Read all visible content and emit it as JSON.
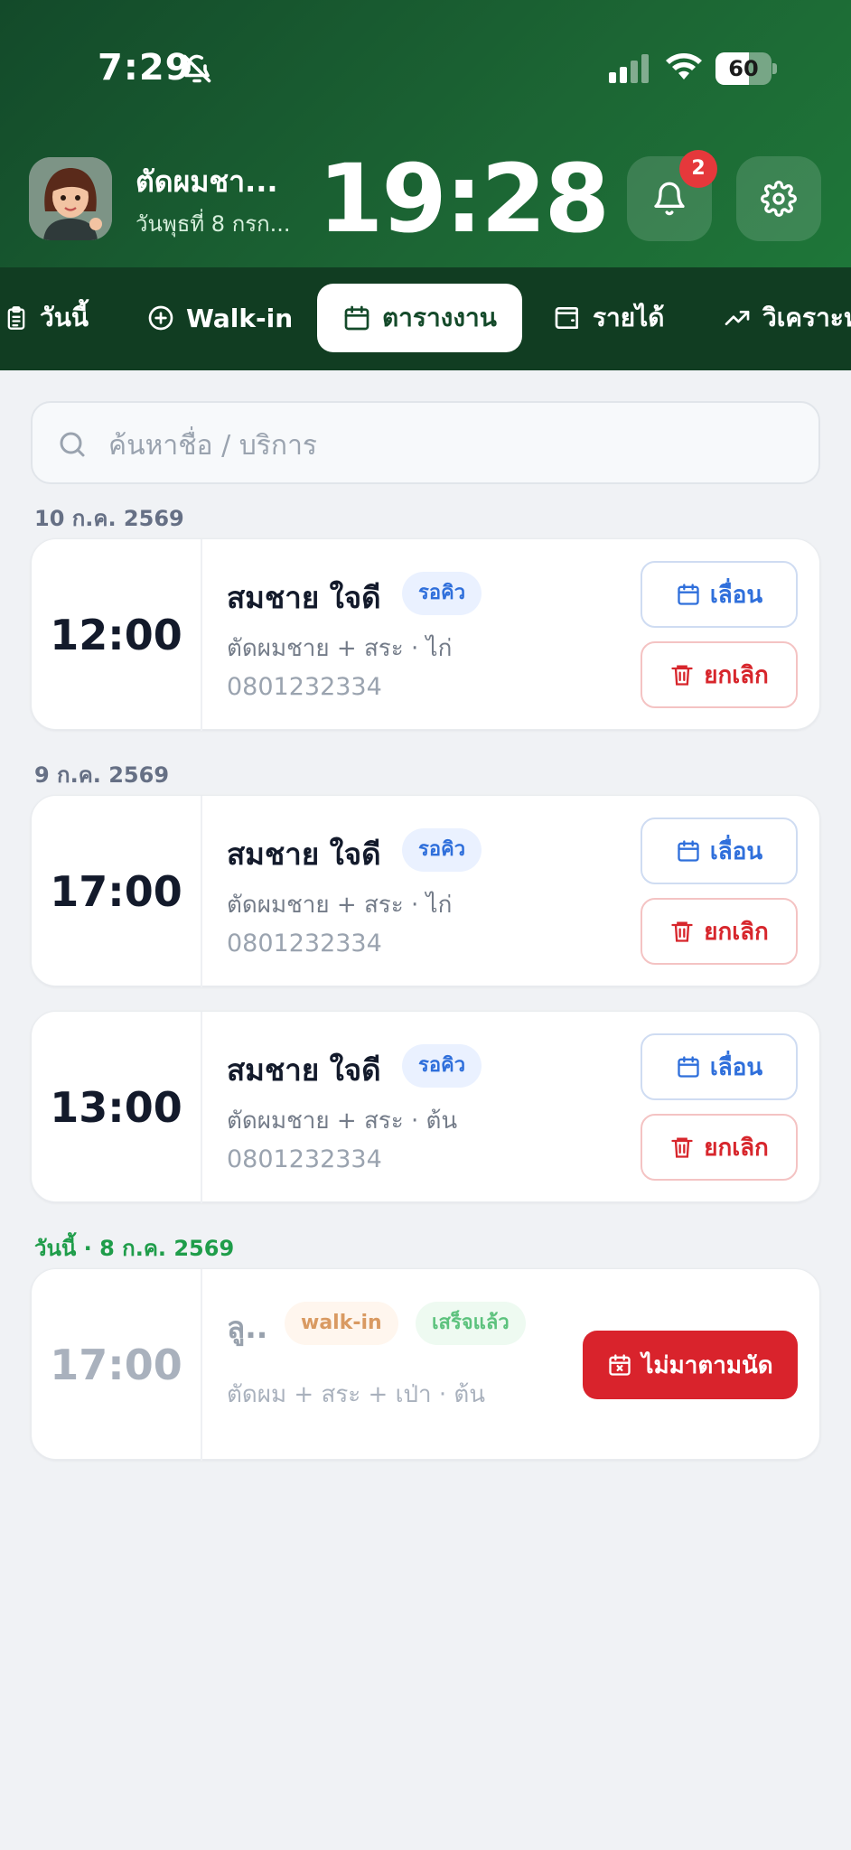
{
  "status_bar": {
    "time": "7:29",
    "battery": 60
  },
  "header": {
    "shop_name": "ตัดผมชา...",
    "date": "วันพุธที่ 8 กรก...",
    "clock": "19:28",
    "notification_count": "2"
  },
  "tabs": [
    {
      "label": "วันนี้",
      "icon": "clipboard-icon"
    },
    {
      "label": "Walk-in",
      "icon": "plus-circle-icon"
    },
    {
      "label": "ตารางงาน",
      "icon": "calendar-icon",
      "active": true
    },
    {
      "label": "รายได้",
      "icon": "wallet-icon"
    },
    {
      "label": "วิเคราะห์",
      "icon": "trend-up-icon"
    }
  ],
  "search": {
    "placeholder": "ค้นหาชื่อ / บริการ"
  },
  "groups": [
    {
      "label": "10 ก.ค. 2569",
      "appointments": [
        {
          "time": "12:00",
          "name": "สมชาย ใจดี",
          "status": "รอคิว",
          "service": "ตัดผมชาย + สระ · ไก่",
          "phone": "0801232334"
        }
      ]
    },
    {
      "label": "9 ก.ค. 2569",
      "appointments": [
        {
          "time": "17:00",
          "name": "สมชาย ใจดี",
          "status": "รอคิว",
          "service": "ตัดผมชาย + สระ · ไก่",
          "phone": "0801232334"
        },
        {
          "time": "13:00",
          "name": "สมชาย ใจดี",
          "status": "รอคิว",
          "service": "ตัดผมชาย + สระ · ต้น",
          "phone": "0801232334"
        }
      ]
    },
    {
      "label": "วันนี้ · 8 ก.ค. 2569",
      "appointments": [
        {
          "time": "17:00",
          "name": "ลู..",
          "type": "walk-in",
          "status": "เสร็จแล้ว",
          "service": "ตัดผม + สระ + เป่า · ต้น"
        }
      ]
    }
  ],
  "actions": {
    "reschedule": "เลื่อน",
    "cancel": "ยกเลิก",
    "no_show": "ไม่มาตามนัด"
  },
  "colors": {
    "header_green": "#1c6634",
    "tab_bar": "#113d22",
    "accent_blue": "#2f6fdb",
    "danger_red": "#d9232c",
    "today_green": "#1f9d4a"
  }
}
